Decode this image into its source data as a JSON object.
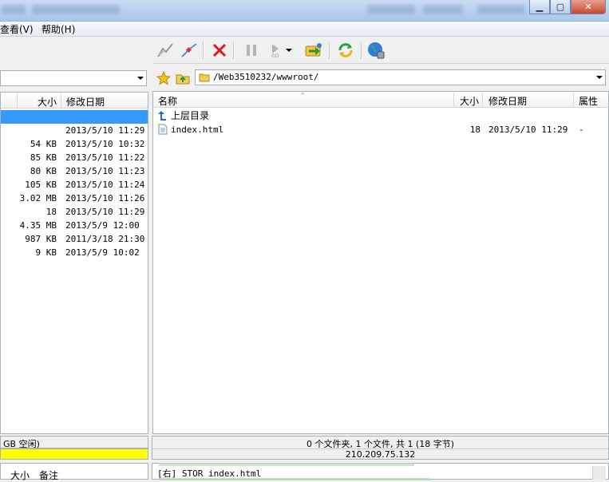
{
  "menu": {
    "view": "查看(V)",
    "help": "帮助(H)"
  },
  "remote": {
    "address": "/Web3510232/wwwroot/",
    "columns": {
      "name": "名称",
      "size": "大小",
      "date": "修改日期",
      "attr": "属性"
    },
    "parent_dir": "上层目录",
    "files": [
      {
        "name": "index.html",
        "size": "18",
        "date": "2013/5/10 11:29",
        "attr": "-"
      }
    ],
    "status_summary": "0 个文件夹, 1 个文件, 共 1 (18 字节)",
    "status_ip": "210.209.75.132"
  },
  "local": {
    "columns": {
      "size": "大小",
      "date": "修改日期"
    },
    "rows": [
      {
        "size": "",
        "date": ""
      },
      {
        "size": "",
        "date": "2013/5/10 11:29"
      },
      {
        "size": "54 KB",
        "date": "2013/5/10 10:32"
      },
      {
        "size": "85 KB",
        "date": "2013/5/10 11:22"
      },
      {
        "size": "80 KB",
        "date": "2013/5/10 11:23"
      },
      {
        "size": "105 KB",
        "date": "2013/5/10 11:24"
      },
      {
        "size": "3.02 MB",
        "date": "2013/5/10 11:26"
      },
      {
        "size": "18",
        "date": "2013/5/10 11:29"
      },
      {
        "size": "4.35 MB",
        "date": "2013/5/9 12:00"
      },
      {
        "size": "987 KB",
        "date": "2011/3/18 21:30"
      },
      {
        "size": "9 KB",
        "date": "2013/5/9 10:02"
      }
    ],
    "status_free": "GB 空闲)"
  },
  "queue": {
    "col_size": "大小",
    "col_note": "备注"
  },
  "log": {
    "line1": "[右] STOR index.html"
  },
  "colors": {
    "selection": "#3399ff",
    "disk_bar": "#ffff00"
  }
}
